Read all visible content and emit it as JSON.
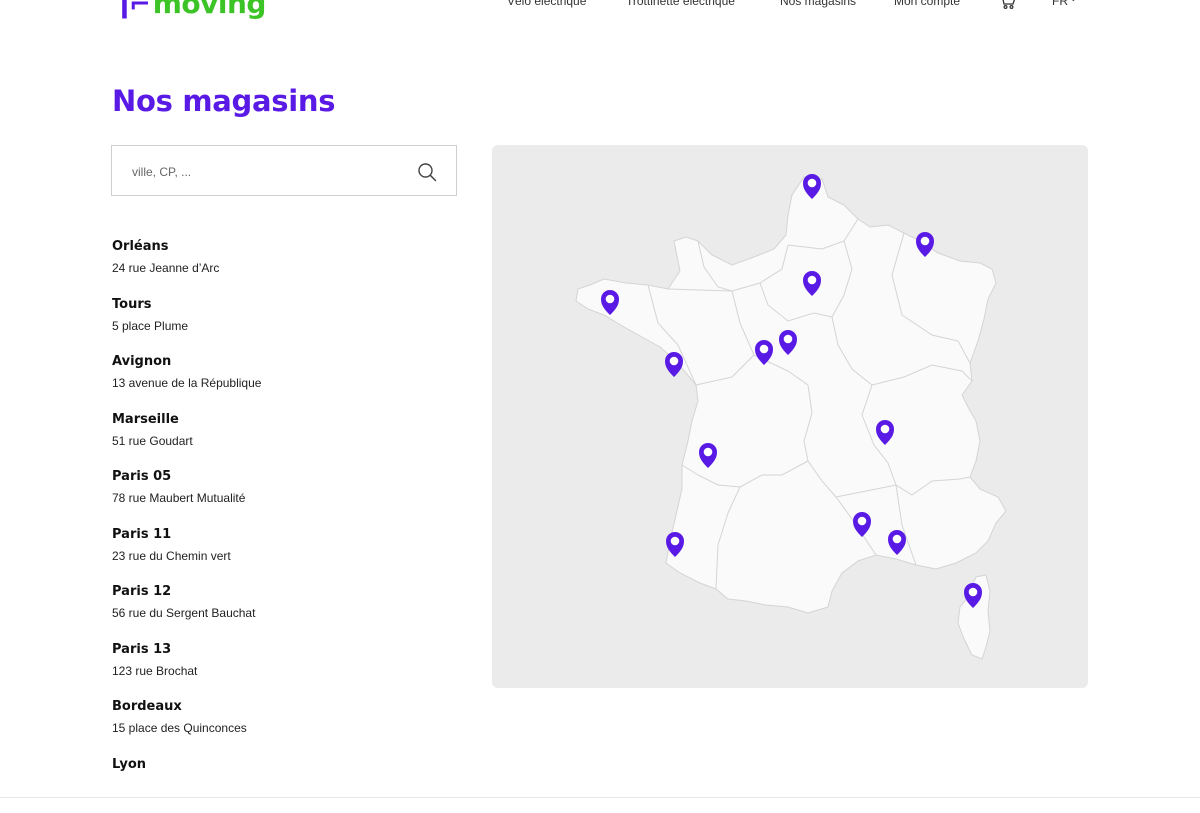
{
  "header": {
    "logo_mark": "₰",
    "logo_text": "moving",
    "nav": [
      {
        "label": "Vélo électrique"
      },
      {
        "label": "Trottinette électrique"
      },
      {
        "label": "Nos magasins"
      },
      {
        "label": "Mon compte"
      }
    ],
    "cart_icon": "cart-icon",
    "language": "FR"
  },
  "page": {
    "title": "Nos magasins"
  },
  "search": {
    "placeholder": "ville, CP, ...",
    "value": "",
    "icon": "search-icon"
  },
  "stores": [
    {
      "name": "Orléans",
      "address": "24 rue Jeanne d’Arc"
    },
    {
      "name": "Tours",
      "address": "5 place Plume"
    },
    {
      "name": "Avignon",
      "address": "13 avenue de la République"
    },
    {
      "name": "Marseille",
      "address": "51 rue Goudart"
    },
    {
      "name": "Paris 05",
      "address": "78 rue Maubert Mutualité"
    },
    {
      "name": "Paris 11",
      "address": "23 rue du Chemin vert"
    },
    {
      "name": "Paris 12",
      "address": "56 rue du Sergent Bauchat"
    },
    {
      "name": "Paris 13",
      "address": "123 rue Brochat"
    },
    {
      "name": "Bordeaux",
      "address": "15 place des Quinconces"
    },
    {
      "name": "Lyon",
      "address": ""
    }
  ],
  "map": {
    "marker_icon": "map-pin-icon",
    "marker_color": "#5a1ae6",
    "land_color": "#fafafa",
    "water_color": "#ebebeb",
    "border_color": "#d4d4d4"
  },
  "colors": {
    "brand_purple": "#5a1ae6",
    "brand_green": "#3cc326"
  }
}
